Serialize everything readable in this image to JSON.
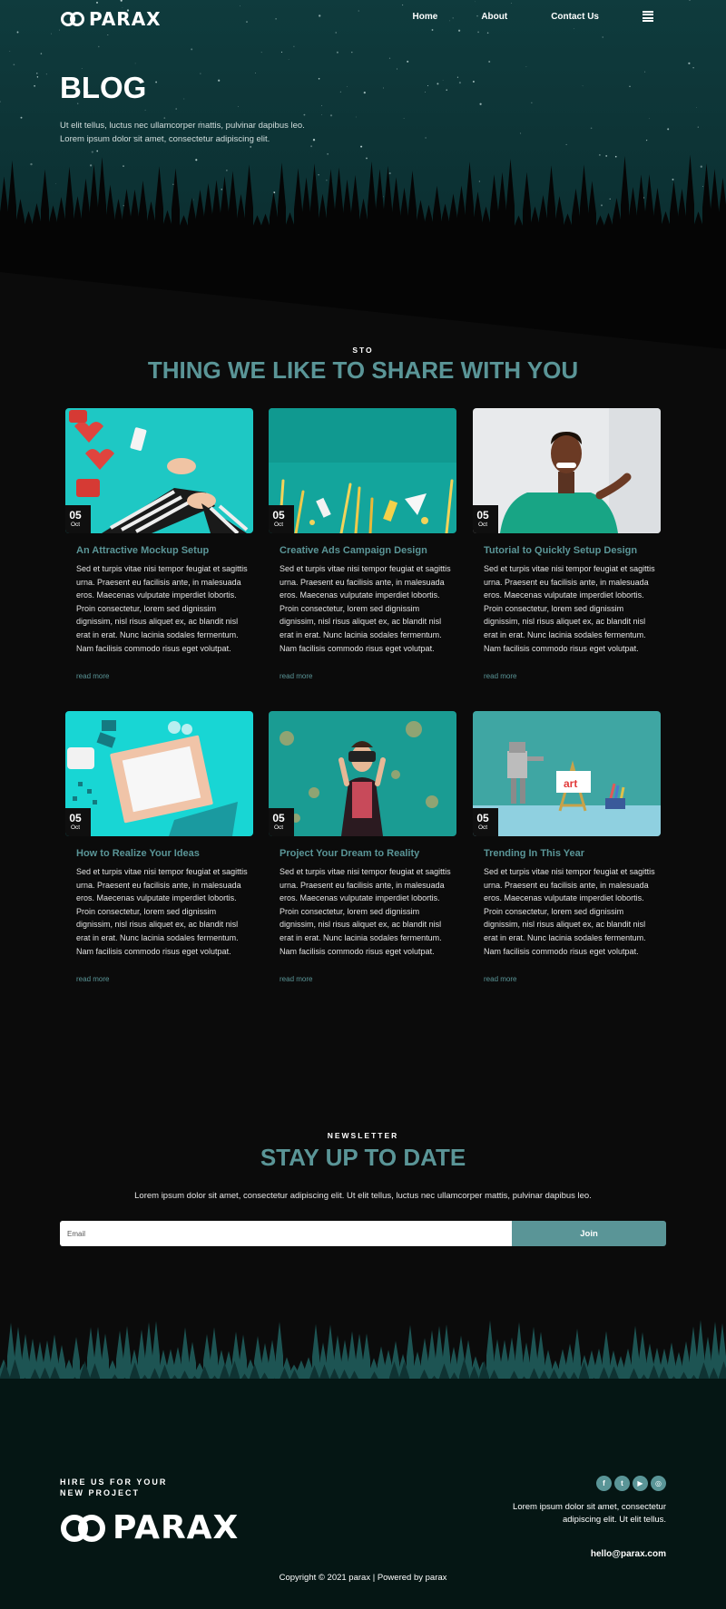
{
  "brand": {
    "name": "PARAX"
  },
  "nav": {
    "items": [
      "Home",
      "About",
      "Contact Us"
    ],
    "menu_icon": "hamburger-icon"
  },
  "hero": {
    "title": "BLOG",
    "subtitle": "Ut elit tellus, luctus nec ullamcorper mattis, pulvinar dapibus leo. Lorem ipsum dolor sit amet, consectetur adipiscing elit."
  },
  "blog": {
    "eyebrow": "STO",
    "title": "THING WE LIKE TO SHARE WITH YOU",
    "read_more": "read more",
    "excerpt": "Sed et turpis vitae nisi tempor feugiat et sagittis urna. Praesent eu facilisis ante, in malesuada eros. Maecenas vulputate imperdiet lobortis. Proin consectetur, lorem sed dignissim dignissim, nisl risus aliquet ex, ac blandit nisl erat in erat. Nunc lacinia sodales fermentum. Nam facilisis commodo risus eget volutpat.",
    "posts": [
      {
        "title": "An Attractive Mockup Setup",
        "day": "05",
        "month": "Oct"
      },
      {
        "title": "Creative Ads Campaign Design",
        "day": "05",
        "month": "Oct"
      },
      {
        "title": "Tutorial to Quickly Setup Design",
        "day": "05",
        "month": "Oct"
      },
      {
        "title": "How to Realize Your Ideas",
        "day": "05",
        "month": "Oct"
      },
      {
        "title": "Project Your Dream to Reality",
        "day": "05",
        "month": "Oct"
      },
      {
        "title": "Trending In This Year",
        "day": "05",
        "month": "Oct"
      }
    ]
  },
  "newsletter": {
    "eyebrow": "NEWSLETTER",
    "title": "STAY UP TO DATE",
    "subtitle": "Lorem ipsum dolor sit amet, consectetur adipiscing elit. Ut elit tellus, luctus nec ullamcorper mattis, pulvinar dapibus leo.",
    "email_placeholder": "Email",
    "button_label": "Join"
  },
  "footer": {
    "eyebrow": "HIRE US FOR YOUR NEW PROJECT",
    "text": "Lorem ipsum dolor sit amet, consectetur adipiscing elit. Ut elit tellus.",
    "email": "hello@parax.com",
    "copyright": "Copyright © 2021 parax | Powered by parax",
    "socials": [
      "facebook-icon",
      "twitter-icon",
      "youtube-icon",
      "dribbble-icon"
    ]
  },
  "colors": {
    "accent": "#5a9597",
    "hero_bg": "#0f3b3d",
    "page_bg": "#0b0b0b",
    "footer_bg": "#051614"
  }
}
